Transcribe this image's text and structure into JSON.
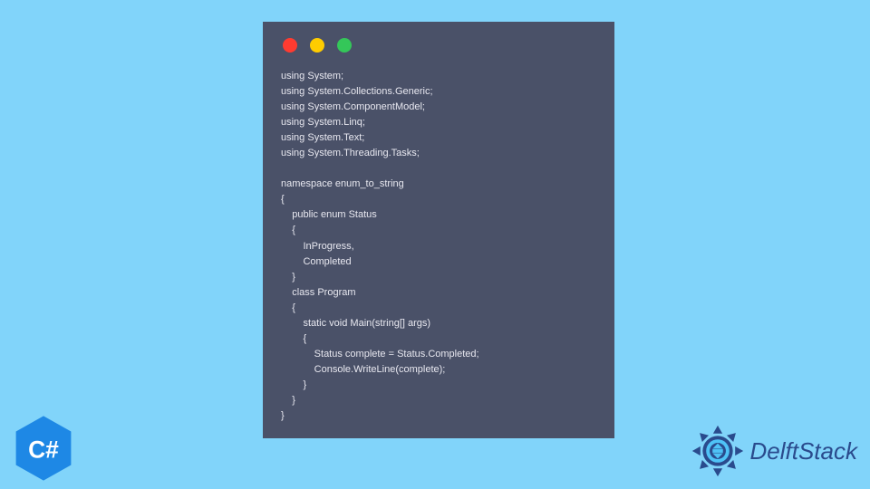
{
  "window": {
    "dots": [
      "red",
      "yellow",
      "green"
    ]
  },
  "code": {
    "lines": [
      "using System;",
      "using System.Collections.Generic;",
      "using System.ComponentModel;",
      "using System.Linq;",
      "using System.Text;",
      "using System.Threading.Tasks;",
      "",
      "namespace enum_to_string",
      "{",
      "    public enum Status",
      "    {",
      "        InProgress,",
      "        Completed",
      "    }",
      "    class Program",
      "    {",
      "        static void Main(string[] args)",
      "        {",
      "            Status complete = Status.Completed;",
      "            Console.WriteLine(complete);",
      "        }",
      "    }",
      "}"
    ]
  },
  "badge": {
    "label": "C#"
  },
  "brand": {
    "name": "DelftStack"
  }
}
